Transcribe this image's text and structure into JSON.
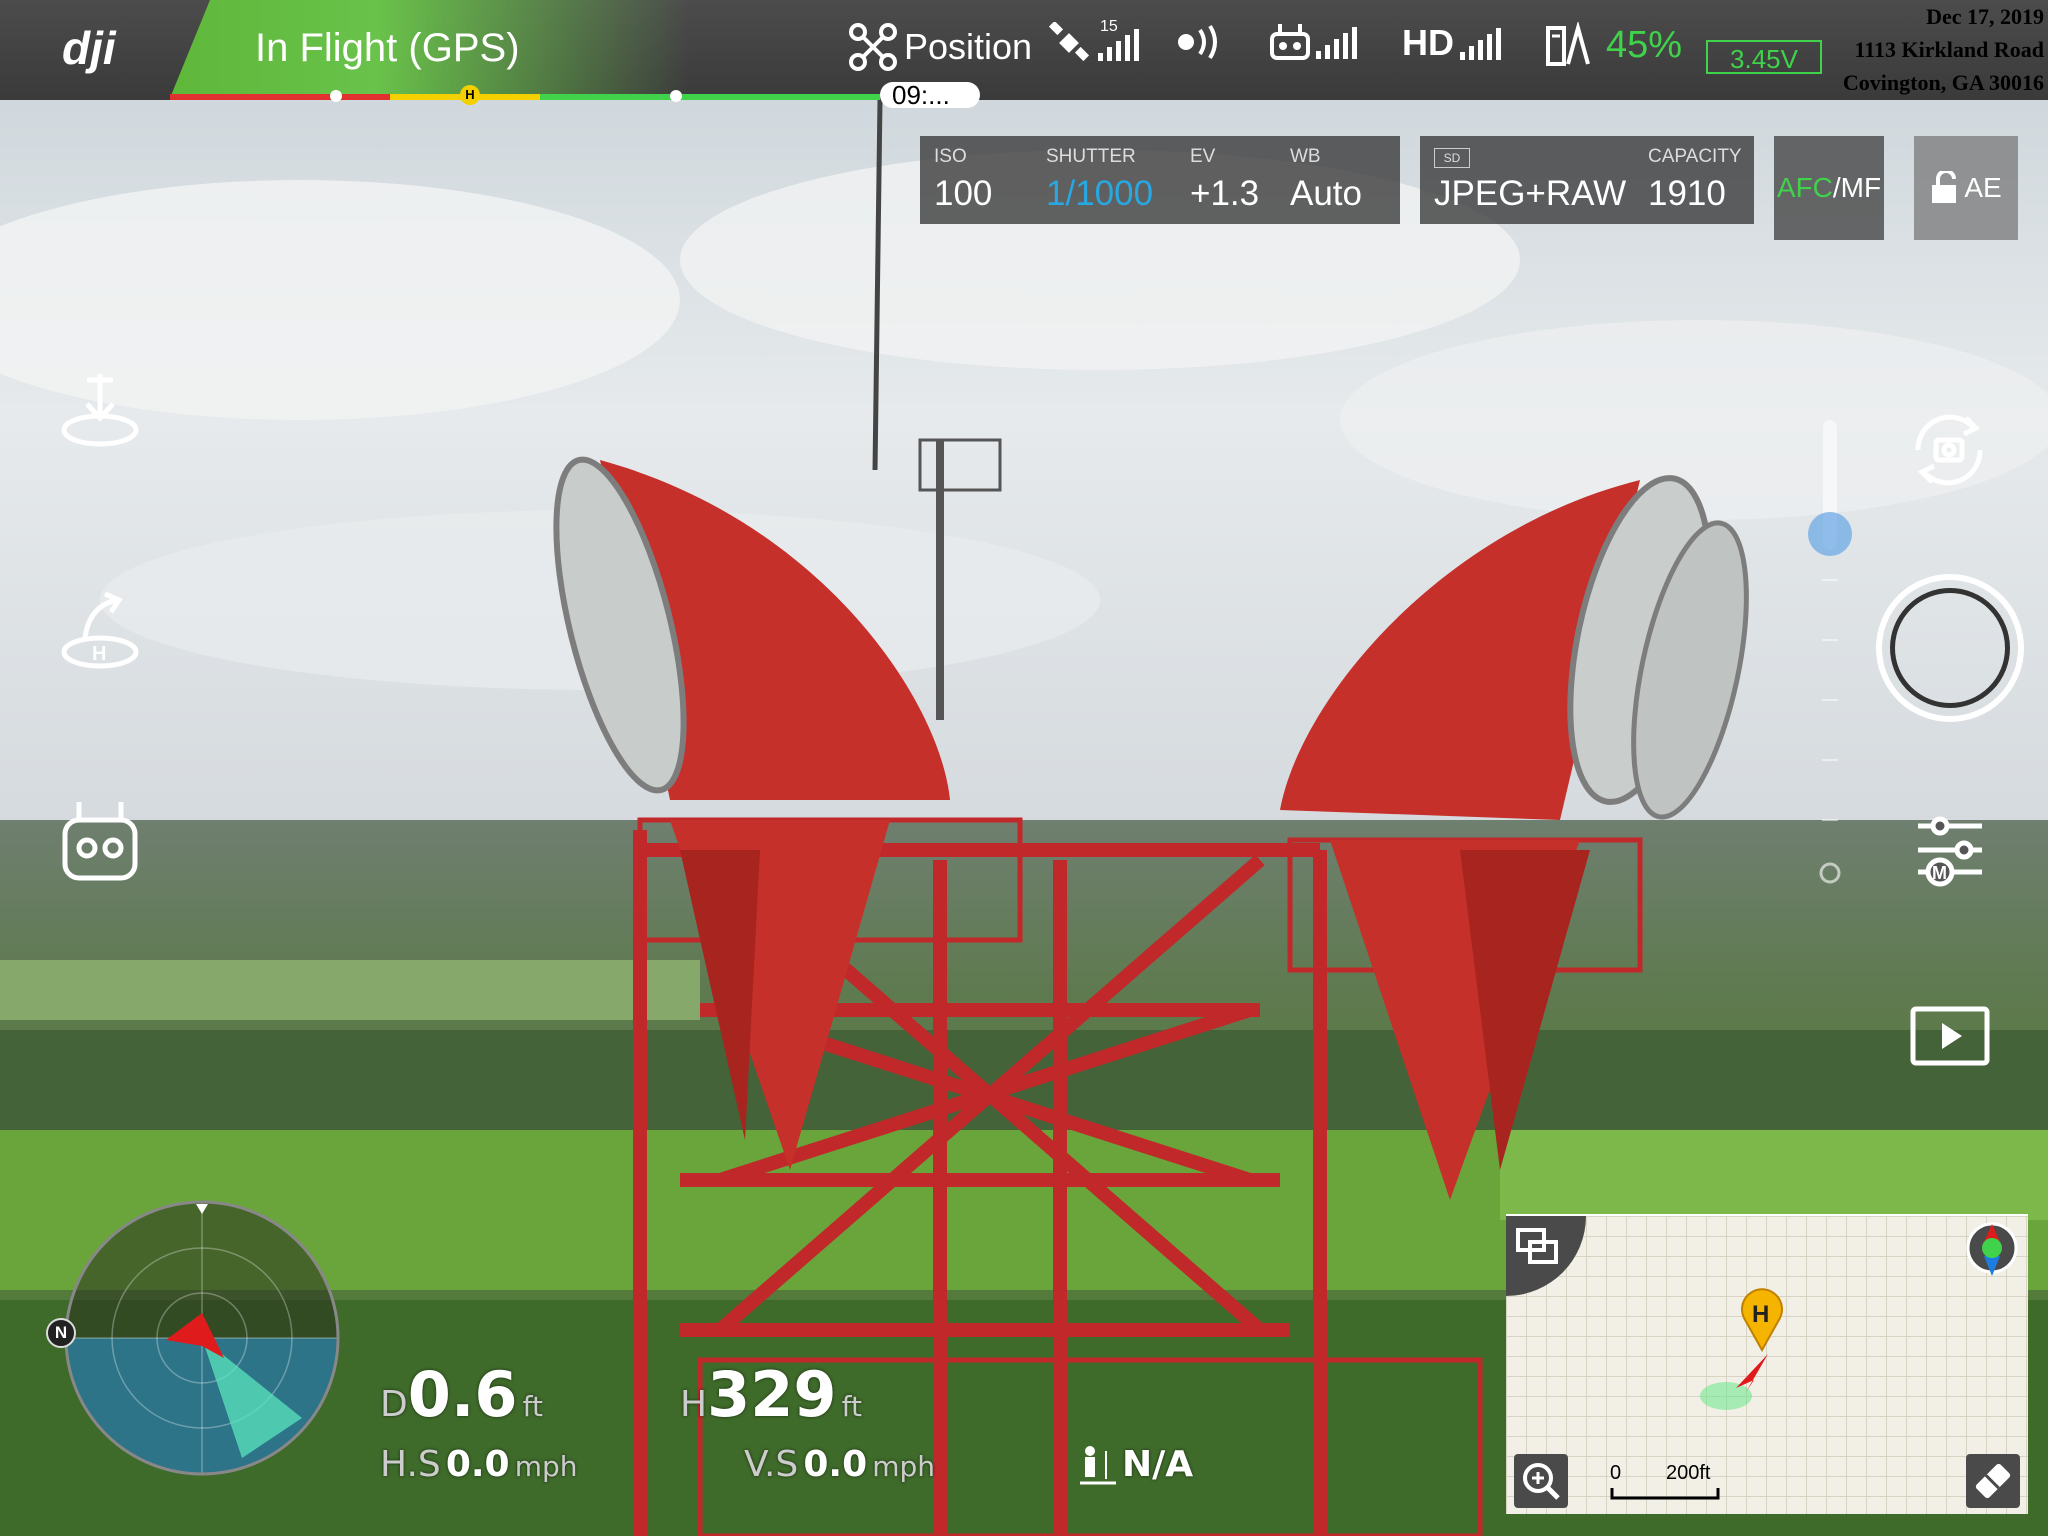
{
  "app": {
    "brand": "dji",
    "flight_mode": "In Flight (GPS)"
  },
  "status": {
    "mode_label": "Position",
    "satellite_count": "15",
    "battery_percent": "45%",
    "battery_voltage": "3.45V",
    "video_link_label": "HD",
    "flight_time": "09:..."
  },
  "metadata": {
    "date": "Dec 17, 2019",
    "address_line1": "1113 Kirkland Road",
    "address_line2": "Covington, GA 30016"
  },
  "camera": {
    "iso_label": "ISO",
    "iso": "100",
    "shutter_label": "SHUTTER",
    "shutter": "1/1000",
    "ev_label": "EV",
    "ev": "+1.3",
    "wb_label": "WB",
    "wb": "Auto",
    "sd_label": "SD",
    "format": "JPEG+RAW",
    "capacity_label": "CAPACITY",
    "capacity": "1910",
    "focus_afc": "AFC",
    "focus_mf": "/MF",
    "ae_label": "AE"
  },
  "telemetry": {
    "d_label": "D",
    "distance": "0.6",
    "distance_unit": "ft",
    "h_label": "H",
    "height": "329",
    "height_unit": "ft",
    "hs_label": "H.S",
    "h_speed": "0.0",
    "h_speed_unit": "mph",
    "vs_label": "V.S",
    "v_speed": "0.0",
    "v_speed_unit": "mph",
    "vps_value": "N/A"
  },
  "radar": {
    "north_label": "N"
  },
  "map": {
    "home_label": "H",
    "scale_start": "0",
    "scale_end": "200ft"
  },
  "colors": {
    "accent_green": "#3fd24a",
    "shutter_blue": "#29a7e1",
    "home_yellow": "#f4d000",
    "aircraft_red": "#e01b1b"
  }
}
